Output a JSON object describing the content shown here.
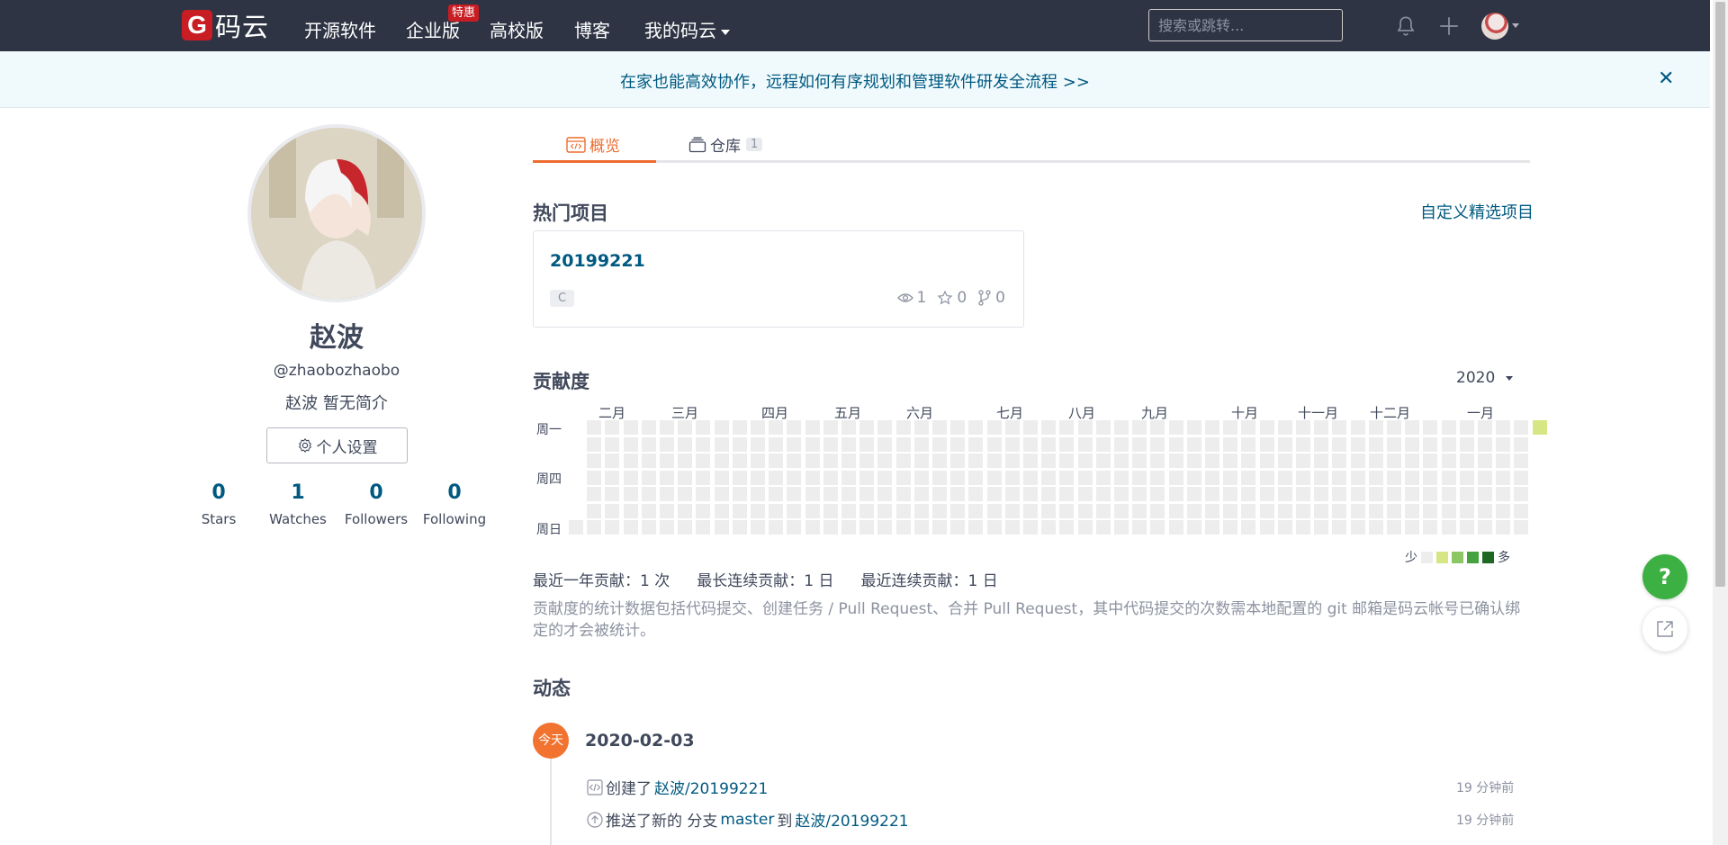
{
  "header": {
    "logo_text": "码云",
    "nav": [
      "开源软件",
      "企业版",
      "高校版",
      "博客",
      "我的码云"
    ],
    "promo_badge": "特惠",
    "search_placeholder": "搜索或跳转..."
  },
  "banner": {
    "text": "在家也能高效协作，远程如何有序规划和管理软件研发全流程 >>",
    "close": "✕"
  },
  "profile": {
    "name": "赵波",
    "handle": "@zhaobozhaobo",
    "bio": "赵波 暂无简介",
    "settings_label": "个人设置",
    "stats": [
      {
        "num": "0",
        "label": "Stars"
      },
      {
        "num": "1",
        "label": "Watches"
      },
      {
        "num": "0",
        "label": "Followers"
      },
      {
        "num": "0",
        "label": "Following"
      }
    ]
  },
  "tabs": [
    {
      "label": "概览"
    },
    {
      "label": "仓库",
      "count": "1"
    }
  ],
  "popular": {
    "title": "热门项目",
    "customize_link": "自定义精选项目",
    "project": {
      "name": "20199221",
      "lang": "C",
      "watch": "1",
      "star": "0",
      "fork": "0"
    }
  },
  "contribution": {
    "title": "贡献度",
    "year": "2020",
    "months": [
      "二月",
      "三月",
      "四月",
      "五月",
      "六月",
      "七月",
      "八月",
      "九月",
      "十月",
      "十一月",
      "十二月",
      "一月"
    ],
    "days": [
      "周一",
      "周四",
      "周日"
    ],
    "legend_less": "少",
    "legend_more": "多",
    "legend_colors": [
      "#ededed",
      "#d6e685",
      "#8cc665",
      "#44a340",
      "#1e6823"
    ],
    "summary": [
      "最近一年贡献：1 次",
      "最长连续贡献：1 日",
      "最近连续贡献：1 日"
    ],
    "note": "贡献度的统计数据包括代码提交、创建任务 / Pull Request、合并 Pull Request，其中代码提交的次数需本地配置的 git 邮箱是码云帐号已确认绑定的才会被统计。"
  },
  "activity": {
    "title": "动态",
    "today": "今天",
    "date": "2020-02-03",
    "items": [
      {
        "pre": "创建了",
        "link": "赵波/20199221",
        "mid": "",
        "branch": "",
        "to": "",
        "time": "19 分钟前"
      },
      {
        "pre": "推送了新的 分支",
        "branch": "master",
        "to": "到",
        "link": "赵波/20199221",
        "time": "19 分钟前"
      }
    ]
  },
  "floating": {
    "help": "?"
  }
}
